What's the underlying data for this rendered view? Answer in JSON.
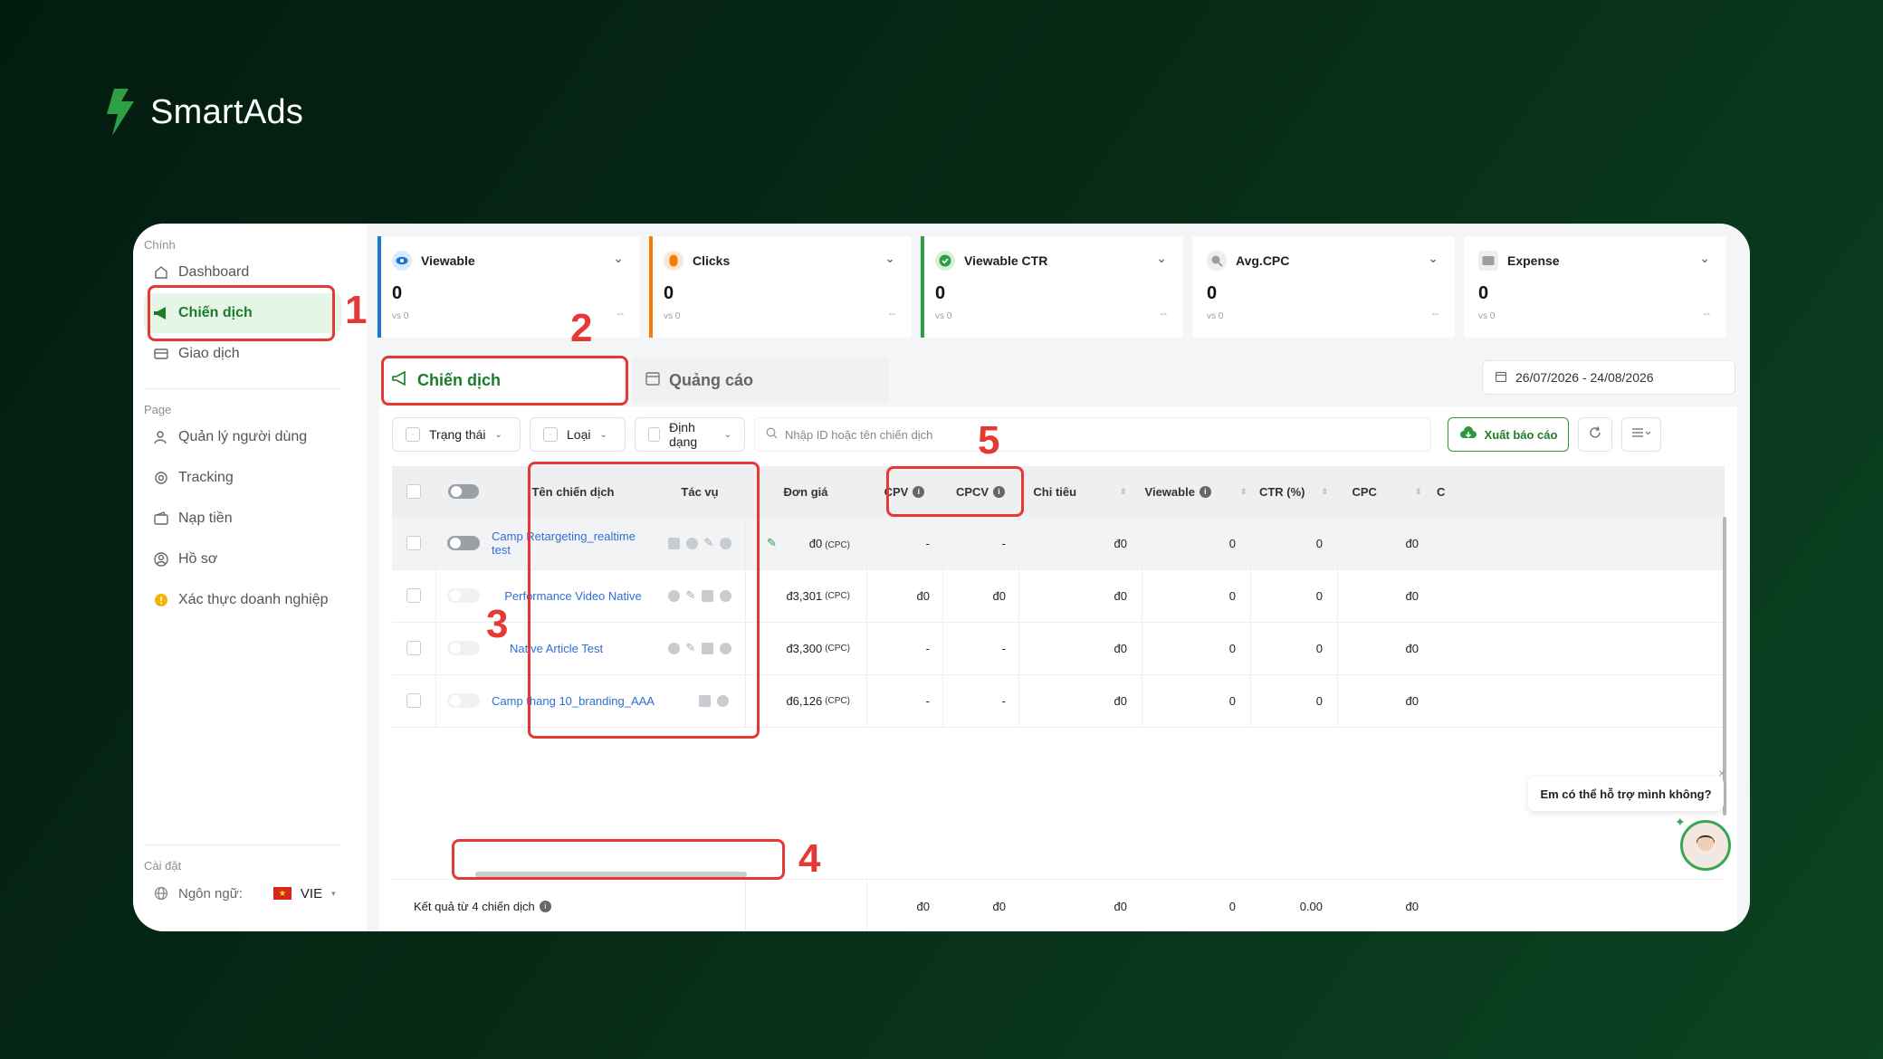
{
  "brand": {
    "name": "SmartAds",
    "color": "#2ea043"
  },
  "sidebar": {
    "section_main": "Chính",
    "items_main": [
      {
        "label": "Dashboard",
        "icon": "home-icon"
      },
      {
        "label": "Chiến dịch",
        "icon": "megaphone-icon",
        "active": true
      },
      {
        "label": "Giao dịch",
        "icon": "card-icon"
      }
    ],
    "section_page": "Page",
    "items_page": [
      {
        "label": "Quản lý người dùng",
        "icon": "users-icon"
      },
      {
        "label": "Tracking",
        "icon": "target-icon"
      },
      {
        "label": "Nạp tiền",
        "icon": "wallet-icon"
      },
      {
        "label": "Hồ sơ",
        "icon": "profile-icon"
      },
      {
        "label": "Xác thực doanh nghiệp",
        "icon": "warning-icon"
      }
    ],
    "section_settings": "Cài đặt",
    "language_label": "Ngôn ngữ:",
    "language_value": "VIE"
  },
  "metrics": [
    {
      "label": "Viewable",
      "value": "0",
      "vs": "vs 0",
      "delta": "--",
      "color": "#1976d2"
    },
    {
      "label": "Clicks",
      "value": "0",
      "vs": "vs 0",
      "delta": "--",
      "color": "#f57c00"
    },
    {
      "label": "Viewable CTR",
      "value": "0",
      "vs": "vs 0",
      "delta": "--",
      "color": "#2e9e44"
    },
    {
      "label": "Avg.CPC",
      "value": "0",
      "vs": "vs 0",
      "delta": "--",
      "color": "#9e9e9e"
    },
    {
      "label": "Expense",
      "value": "0",
      "vs": "vs 0",
      "delta": "--",
      "color": "#9e9e9e"
    }
  ],
  "tabs": [
    {
      "label": "Chiến dịch",
      "active": true
    },
    {
      "label": "Quảng cáo",
      "active": false
    }
  ],
  "date_range": "26/07/2026 - 24/08/2026",
  "filters": {
    "status": "Trạng thái",
    "type": "Loại",
    "format": "Định dạng"
  },
  "search_placeholder": "Nhập ID hoặc tên chiến dịch",
  "export_label": "Xuất báo cáo",
  "columns": {
    "name": "Tên chiến dịch",
    "actions": "Tác vụ",
    "unit_price": "Đơn giá",
    "cpv": "CPV",
    "cpcv": "CPCV",
    "spend": "Chi tiêu",
    "viewable": "Viewable",
    "ctr": "CTR (%)",
    "cpc": "CPC",
    "more": "C"
  },
  "rows": [
    {
      "name": "Camp Retargeting_realtime test",
      "price": "đ0",
      "price_unit": "(CPC)",
      "cpv": "-",
      "cpcv": "-",
      "spend": "đ0",
      "viewable": "0",
      "ctr": "0",
      "cpc": "đ0"
    },
    {
      "name": "Performance Video Native",
      "price": "đ3,301",
      "price_unit": "(CPC)",
      "cpv": "đ0",
      "cpcv": "đ0",
      "spend": "đ0",
      "viewable": "0",
      "ctr": "0",
      "cpc": "đ0"
    },
    {
      "name": "Native Article Test",
      "price": "đ3,300",
      "price_unit": "(CPC)",
      "cpv": "-",
      "cpcv": "-",
      "spend": "đ0",
      "viewable": "0",
      "ctr": "0",
      "cpc": "đ0"
    },
    {
      "name": "Camp thang 10_branding_AAA",
      "price": "đ6,126",
      "price_unit": "(CPC)",
      "cpv": "-",
      "cpcv": "-",
      "spend": "đ0",
      "viewable": "0",
      "ctr": "0",
      "cpc": "đ0"
    }
  ],
  "footer": {
    "summary": "Kết quả từ 4 chiến dịch",
    "cpv": "đ0",
    "cpcv": "đ0",
    "spend": "đ0",
    "viewable": "0",
    "ctr": "0.00",
    "cpc": "đ0"
  },
  "chat": {
    "message": "Em có thể hỗ trợ mình không?",
    "close": "×"
  },
  "annotations": [
    "1",
    "2",
    "3",
    "4",
    "5"
  ],
  "annotation_color": "#e53935"
}
